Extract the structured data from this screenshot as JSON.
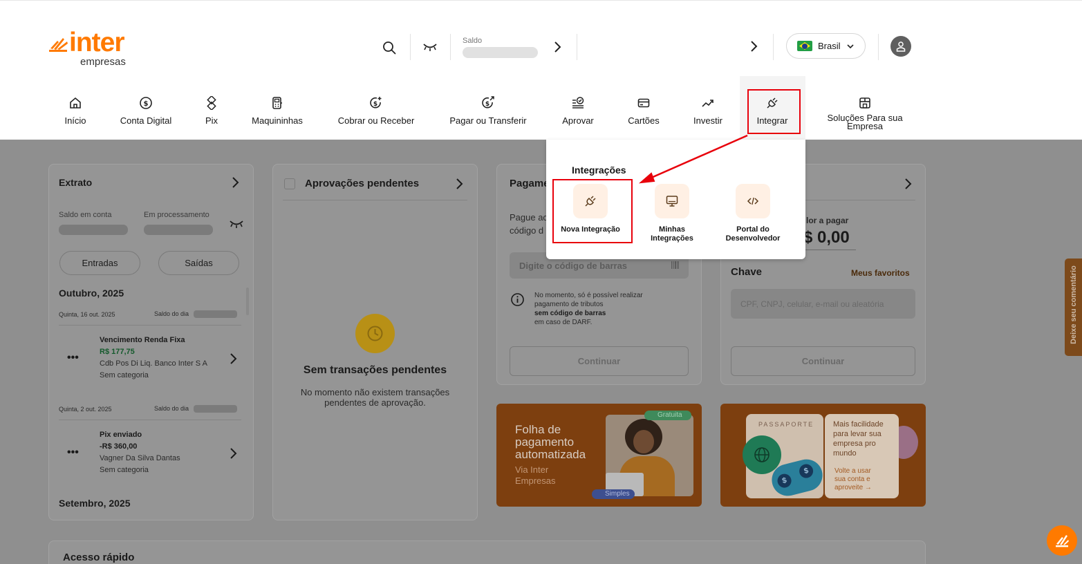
{
  "brand": {
    "logo_word": "inter",
    "logo_sub": "empresas",
    "accent": "#ff7a00"
  },
  "header": {
    "saldo_label": "Saldo",
    "country": "Brasil",
    "icons": [
      "search-icon",
      "eye-closed-icon",
      "chevron-right-icon",
      "user-icon"
    ]
  },
  "nav": {
    "items": [
      {
        "label": "Início",
        "icon": "home-icon"
      },
      {
        "label": "Conta Digital",
        "icon": "dollar-circle-icon"
      },
      {
        "label": "Pix",
        "icon": "pix-icon"
      },
      {
        "label": "Maquininhas",
        "icon": "card-machine-icon"
      },
      {
        "label": "Cobrar ou Receber",
        "icon": "receive-money-icon"
      },
      {
        "label": "Pagar ou Transferir",
        "icon": "send-money-icon"
      },
      {
        "label": "Aprovar",
        "icon": "approve-list-icon"
      },
      {
        "label": "Cartões",
        "icon": "card-icon"
      },
      {
        "label": "Investir",
        "icon": "trend-up-icon"
      },
      {
        "label": "Integrar",
        "icon": "plug-icon"
      },
      {
        "label": "Soluções Para sua Empresa",
        "icon": "store-icon"
      }
    ]
  },
  "dropdown": {
    "title": "Integrações",
    "items": [
      {
        "label": "Nova Integração",
        "icon": "plug-icon"
      },
      {
        "label": "Minhas Integrações",
        "icon": "monitor-icon"
      },
      {
        "label": "Portal do Desenvolvedor",
        "icon": "code-icon"
      }
    ]
  },
  "extrato": {
    "title": "Extrato",
    "saldo_conta": "Saldo em conta",
    "em_processamento": "Em processamento",
    "entradas": "Entradas",
    "saidas": "Saídas",
    "month1": "Outubro, 2025",
    "groups": [
      {
        "date": "Quinta, 16 out. 2025",
        "saldo_dia": "Saldo do dia",
        "title": "Vencimento Renda Fixa",
        "amount": "R$ 177,75",
        "desc": "Cdb Pos Di Liq. Banco Inter S A",
        "cat": "Sem categoria"
      },
      {
        "date": "Quinta, 2 out. 2025",
        "saldo_dia": "Saldo do dia",
        "title": "Pix enviado",
        "amount": "-R$ 360,00",
        "desc": "Vagner Da Silva Dantas",
        "cat": "Sem categoria"
      }
    ],
    "month2": "Setembro, 2025"
  },
  "aprovacoes": {
    "title": "Aprovações pendentes",
    "empty_title": "Sem transações pendentes",
    "empty_text": "No momento não existem transações pendentes de aprovação."
  },
  "pagamento": {
    "title": "Pagame",
    "desc_line1": "Pague ac",
    "desc_line2": "código d",
    "barcode_placeholder": "Digite o código de barras",
    "info_line1": "No momento, só é possível realizar",
    "info_line2": "pagamento de tributos",
    "info_line3": "sem código de barras",
    "info_line4": "em caso de DARF.",
    "continue": "Continuar"
  },
  "pix_card": {
    "valor_label": "lor a pagar",
    "valor": "$ 0,00",
    "chave": "Chave",
    "favoritos": "Meus favoritos",
    "chave_placeholder": "CPF, CNPJ, celular, e-mail ou aleatória",
    "continue": "Continuar"
  },
  "promo1": {
    "line1": "Folha de",
    "line2": "pagamento",
    "line3": "automatizada",
    "sub1": "Via Inter",
    "sub2": "Empresas",
    "badge1": "Gratuita",
    "badge2": "Simples"
  },
  "promo2": {
    "passport": "PASSAPORTE",
    "t1": "Mais facilidade",
    "t2": "para levar sua",
    "t3": "empresa pro",
    "t4": "mundo",
    "t5": "Volte a usar",
    "t6": "sua conta e",
    "t7": "aproveite →"
  },
  "acesso": {
    "title": "Acesso rápido"
  },
  "feedback": {
    "label": "Deixe seu comentário"
  }
}
